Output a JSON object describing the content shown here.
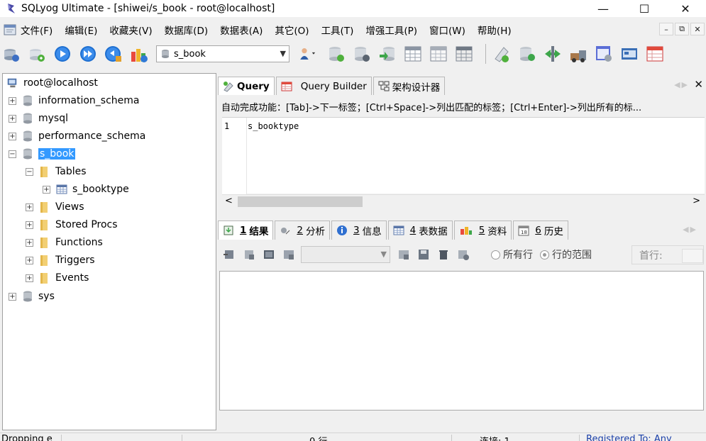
{
  "window": {
    "title": "SQLyog Ultimate - [shiwei/s_book - root@localhost]",
    "minimize": "—",
    "maximize": "☐",
    "close": "✕"
  },
  "menu": {
    "items": [
      "文件(F)",
      "编辑(E)",
      "收藏夹(V)",
      "数据库(D)",
      "数据表(A)",
      "其它(O)",
      "工具(T)",
      "增强工具(P)",
      "窗口(W)",
      "帮助(H)"
    ],
    "mdi_minimize": "–",
    "mdi_restore": "⧉",
    "mdi_close": "✕"
  },
  "toolbar": {
    "db_selected": "s_book"
  },
  "tree": {
    "root": "root@localhost",
    "items": [
      {
        "label": "information_schema"
      },
      {
        "label": "mysql"
      },
      {
        "label": "performance_schema"
      },
      {
        "label": "s_book"
      },
      {
        "label": "Tables"
      },
      {
        "label": "s_booktype"
      },
      {
        "label": "Views"
      },
      {
        "label": "Stored Procs"
      },
      {
        "label": "Functions"
      },
      {
        "label": "Triggers"
      },
      {
        "label": "Events"
      },
      {
        "label": "sys"
      }
    ]
  },
  "query_tabs": [
    {
      "label": "Query"
    },
    {
      "label": "Query Builder"
    },
    {
      "label": "架构设计器"
    }
  ],
  "hint": "自动完成功能：[Tab]->下一标签；[Ctrl+Space]->列出匹配的标签；[Ctrl+Enter]->列出所有的标...",
  "editor": {
    "line_number": "1",
    "code": "s_booktype"
  },
  "result_tabs": [
    {
      "num": "1",
      "label": "结果"
    },
    {
      "num": "2",
      "label": "分析"
    },
    {
      "num": "3",
      "label": "信息"
    },
    {
      "num": "4",
      "label": "表数据"
    },
    {
      "num": "5",
      "label": "资料"
    },
    {
      "num": "6",
      "label": "历史"
    }
  ],
  "result_toolbar": {
    "radio_all": "所有行",
    "radio_range": "行的范围",
    "first_row_label": "首行:"
  },
  "status": {
    "left": "Dropping e",
    "rows": "0 行",
    "conn": "连接: 1",
    "reg": "Registered To: Any"
  },
  "colors": {
    "selection": "#3399ff",
    "background": "#f0f0f0",
    "status_link": "#1a3fa8"
  }
}
